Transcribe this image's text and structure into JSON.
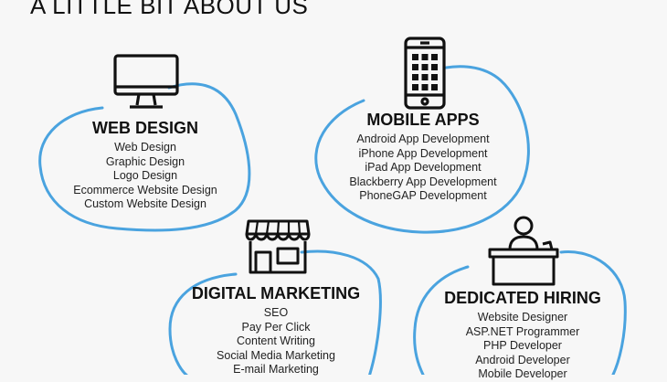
{
  "page": {
    "title": "A LITTLE BIT ABOUT US"
  },
  "colors": {
    "accent": "#4aa3df",
    "text": "#111111",
    "background": "#f7f7f7"
  },
  "services": [
    {
      "title": "WEB DESIGN",
      "icon": "monitor-icon",
      "items": [
        "Web Design",
        "Graphic Design",
        "Logo Design",
        "Ecommerce Website Design",
        "Custom Website Design"
      ]
    },
    {
      "title": "MOBILE APPS",
      "icon": "smartphone-icon",
      "items": [
        "Android App Development",
        "iPhone App Development",
        "iPad App Development",
        "Blackberry App Development",
        "PhoneGAP Development"
      ]
    },
    {
      "title": "DIGITAL MARKETING",
      "icon": "storefront-icon",
      "items": [
        "SEO",
        "Pay Per Click",
        "Content Writing",
        "Social Media Marketing",
        "E-mail Marketing"
      ]
    },
    {
      "title": "DEDICATED HIRING",
      "icon": "reception-desk-icon",
      "items": [
        "Website Designer",
        "ASP.NET Programmer",
        "PHP Developer",
        "Android Developer",
        "Mobile Developer"
      ]
    }
  ]
}
